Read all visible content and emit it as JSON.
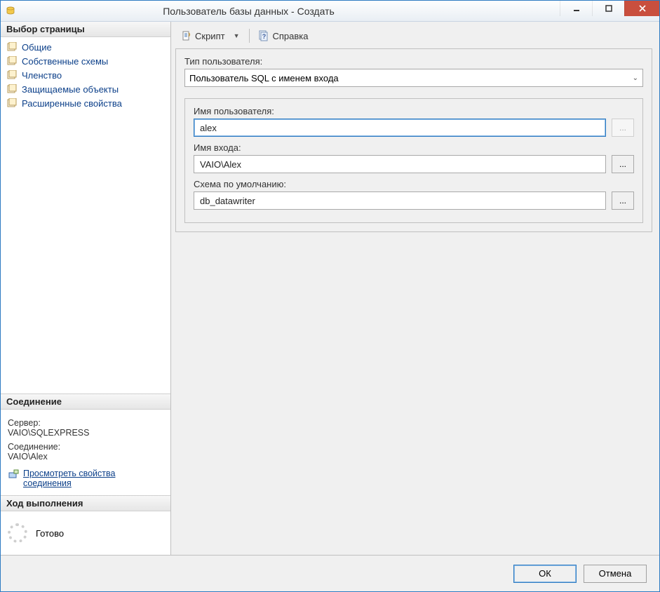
{
  "window": {
    "title": "Пользователь базы данных - Создать"
  },
  "sidebar": {
    "page_selector": {
      "header": "Выбор страницы",
      "items": [
        {
          "label": "Общие"
        },
        {
          "label": "Собственные схемы"
        },
        {
          "label": "Членство"
        },
        {
          "label": "Защищаемые объекты"
        },
        {
          "label": "Расширенные свойства"
        }
      ]
    },
    "connection": {
      "header": "Соединение",
      "server_label": "Сервер:",
      "server_value": "VAIO\\SQLEXPRESS",
      "connection_label": "Соединение:",
      "connection_value": "VAIO\\Alex",
      "view_properties_link": "Просмотреть свойства соединения"
    },
    "progress": {
      "header": "Ход выполнения",
      "status": "Готово"
    }
  },
  "toolbar": {
    "script_label": "Скрипт",
    "help_label": "Справка"
  },
  "main": {
    "user_type_label": "Тип пользователя:",
    "user_type_value": "Пользователь SQL с именем входа",
    "username_label": "Имя пользователя:",
    "username_value": "alex",
    "login_label": "Имя входа:",
    "login_value": "VAIO\\Alex",
    "default_schema_label": "Схема по умолчанию:",
    "default_schema_value": "db_datawriter",
    "browse_label": "..."
  },
  "footer": {
    "ok": "ОК",
    "cancel": "Отмена"
  }
}
